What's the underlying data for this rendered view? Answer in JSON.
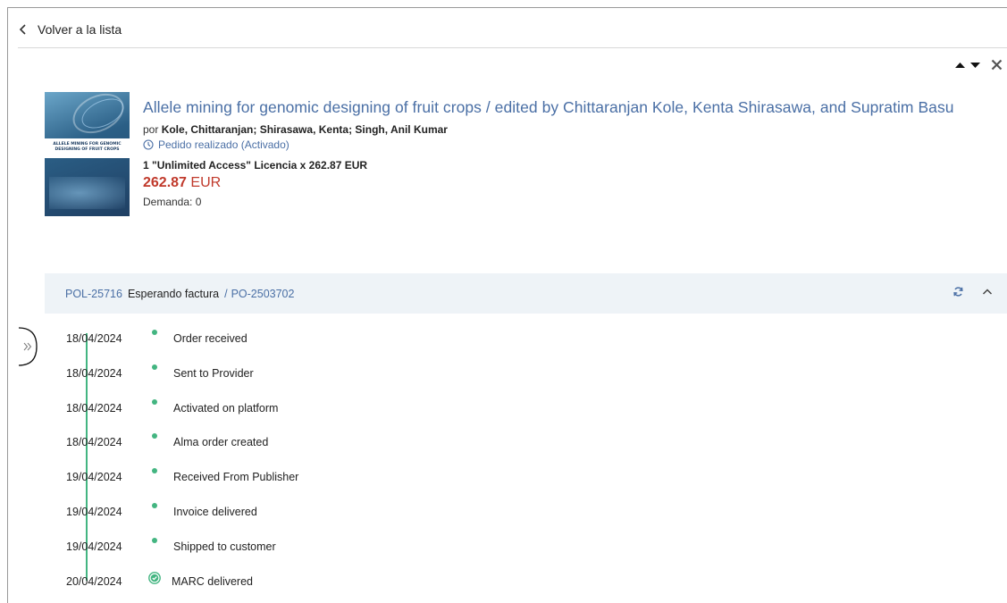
{
  "back": {
    "label": "Volver a la lista"
  },
  "item": {
    "title": "Allele mining for genomic designing of fruit crops / edited by Chittaranjan Kole, Kenta Shirasawa, and Supratim Basu",
    "authors_prefix": "por",
    "authors": "Kole, Chittaranjan; Shirasawa, Kenta; Singh, Anil Kumar",
    "status": "Pedido realizado (Activado)",
    "license": "1 \"Unlimited Access\" Licencia x 262.87 EUR",
    "price_amount": "262.87",
    "price_currency": "EUR",
    "demand": "Demanda: 0",
    "cover_text": "ALLELE MINING FOR GENOMIC DESIGNING OF FRUIT CROPS"
  },
  "po": {
    "pol": "POL-25716",
    "state": "Esperando factura",
    "separator": "/",
    "po_number": "PO-2503702"
  },
  "timeline": [
    {
      "date": "18/04/2024",
      "label": "Order received"
    },
    {
      "date": "18/04/2024",
      "label": "Sent to Provider"
    },
    {
      "date": "18/04/2024",
      "label": "Activated on platform"
    },
    {
      "date": "18/04/2024",
      "label": "Alma order created"
    },
    {
      "date": "19/04/2024",
      "label": "Received From Publisher"
    },
    {
      "date": "19/04/2024",
      "label": "Invoice delivered"
    },
    {
      "date": "19/04/2024",
      "label": "Shipped to customer"
    },
    {
      "date": "20/04/2024",
      "label": "MARC delivered"
    }
  ],
  "colors": {
    "accent": "#4a6fa5",
    "price": "#c0392b",
    "timeline": "#43b581",
    "bar_bg": "#eef3f7"
  },
  "icons": {
    "back": "chevron-left-icon",
    "up": "triangle-up-icon",
    "down": "triangle-down-icon",
    "close": "close-icon",
    "status": "clock-icon",
    "refresh": "refresh-icon",
    "collapse": "chevron-up-icon",
    "side": "double-chevron-right-icon",
    "done": "check-circle-icon"
  }
}
